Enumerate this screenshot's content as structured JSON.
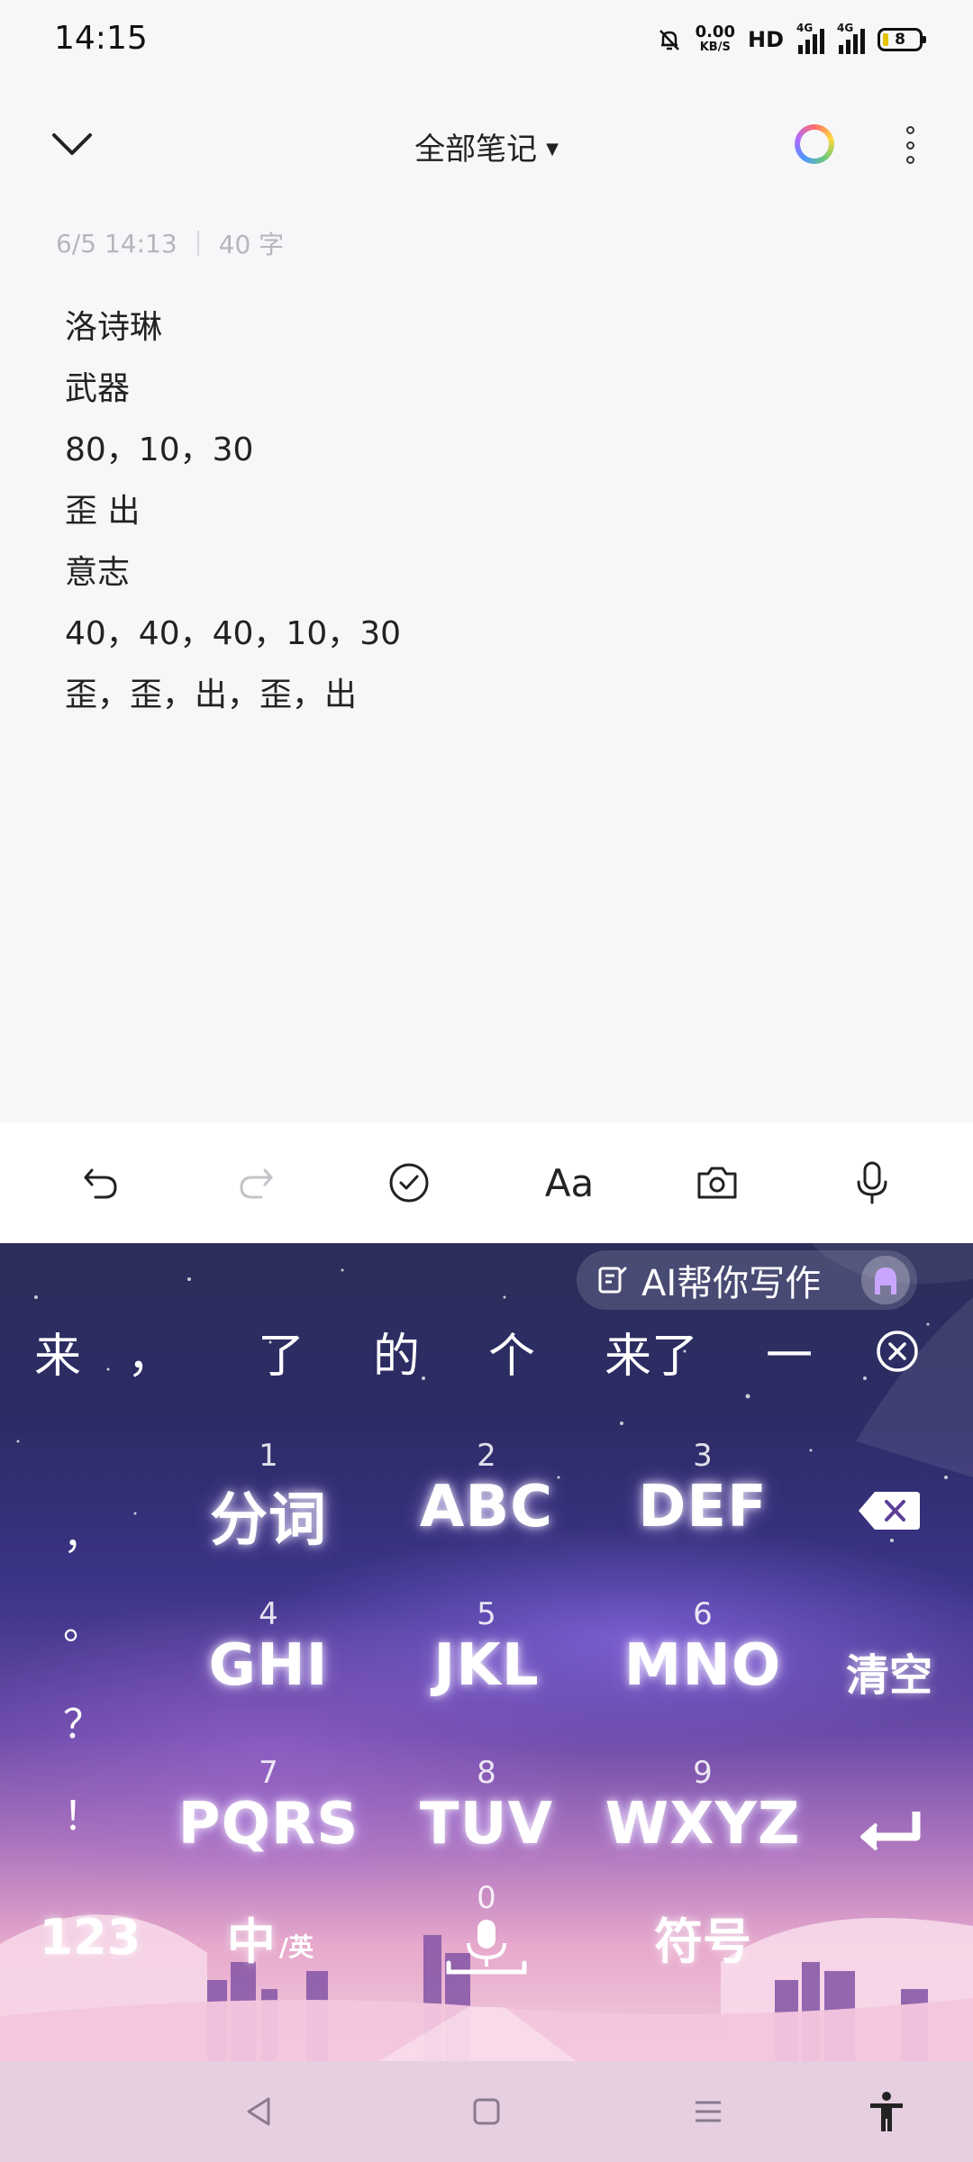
{
  "status_bar": {
    "time": "14:15",
    "net_speed": "0.00",
    "net_unit": "KB/S",
    "hd_label": "HD",
    "signal1_label": "4G",
    "signal2_label": "4G",
    "battery": "8"
  },
  "header": {
    "title": "全部笔记"
  },
  "meta": {
    "datetime": "6/5 14:13",
    "word_count": "40 字"
  },
  "note": {
    "lines": [
      "洛诗琳",
      "武器",
      "80，10，30",
      "歪 出",
      "意志",
      "40，40，40，10，30",
      "歪，歪，出，歪，出"
    ]
  },
  "toolbar": {
    "format_label": "Aa"
  },
  "keyboard": {
    "ai_label": "AI帮你写作",
    "candidates": [
      "来",
      "，",
      "了",
      "的",
      "个",
      "来了",
      "一"
    ],
    "punctuation": [
      "，",
      "。",
      "？",
      "！"
    ],
    "keys": [
      {
        "num": "1",
        "letters": "分词"
      },
      {
        "num": "2",
        "letters": "ABC"
      },
      {
        "num": "3",
        "letters": "DEF"
      },
      {
        "num": "4",
        "letters": "GHI"
      },
      {
        "num": "5",
        "letters": "JKL"
      },
      {
        "num": "6",
        "letters": "MNO"
      },
      {
        "num": "7",
        "letters": "PQRS"
      },
      {
        "num": "8",
        "letters": "TUV"
      },
      {
        "num": "9",
        "letters": "WXYZ"
      }
    ],
    "clear_label": "清空",
    "zero_num": "0",
    "num_mode_label": "123",
    "lang_main": "中",
    "lang_sub": "/英",
    "symbol_label": "符号"
  },
  "colors": {
    "accent_keyboard_top": "#2b2e5a",
    "accent_keyboard_bottom": "#f3cde0",
    "nav_bar": "#e6cfe0"
  }
}
